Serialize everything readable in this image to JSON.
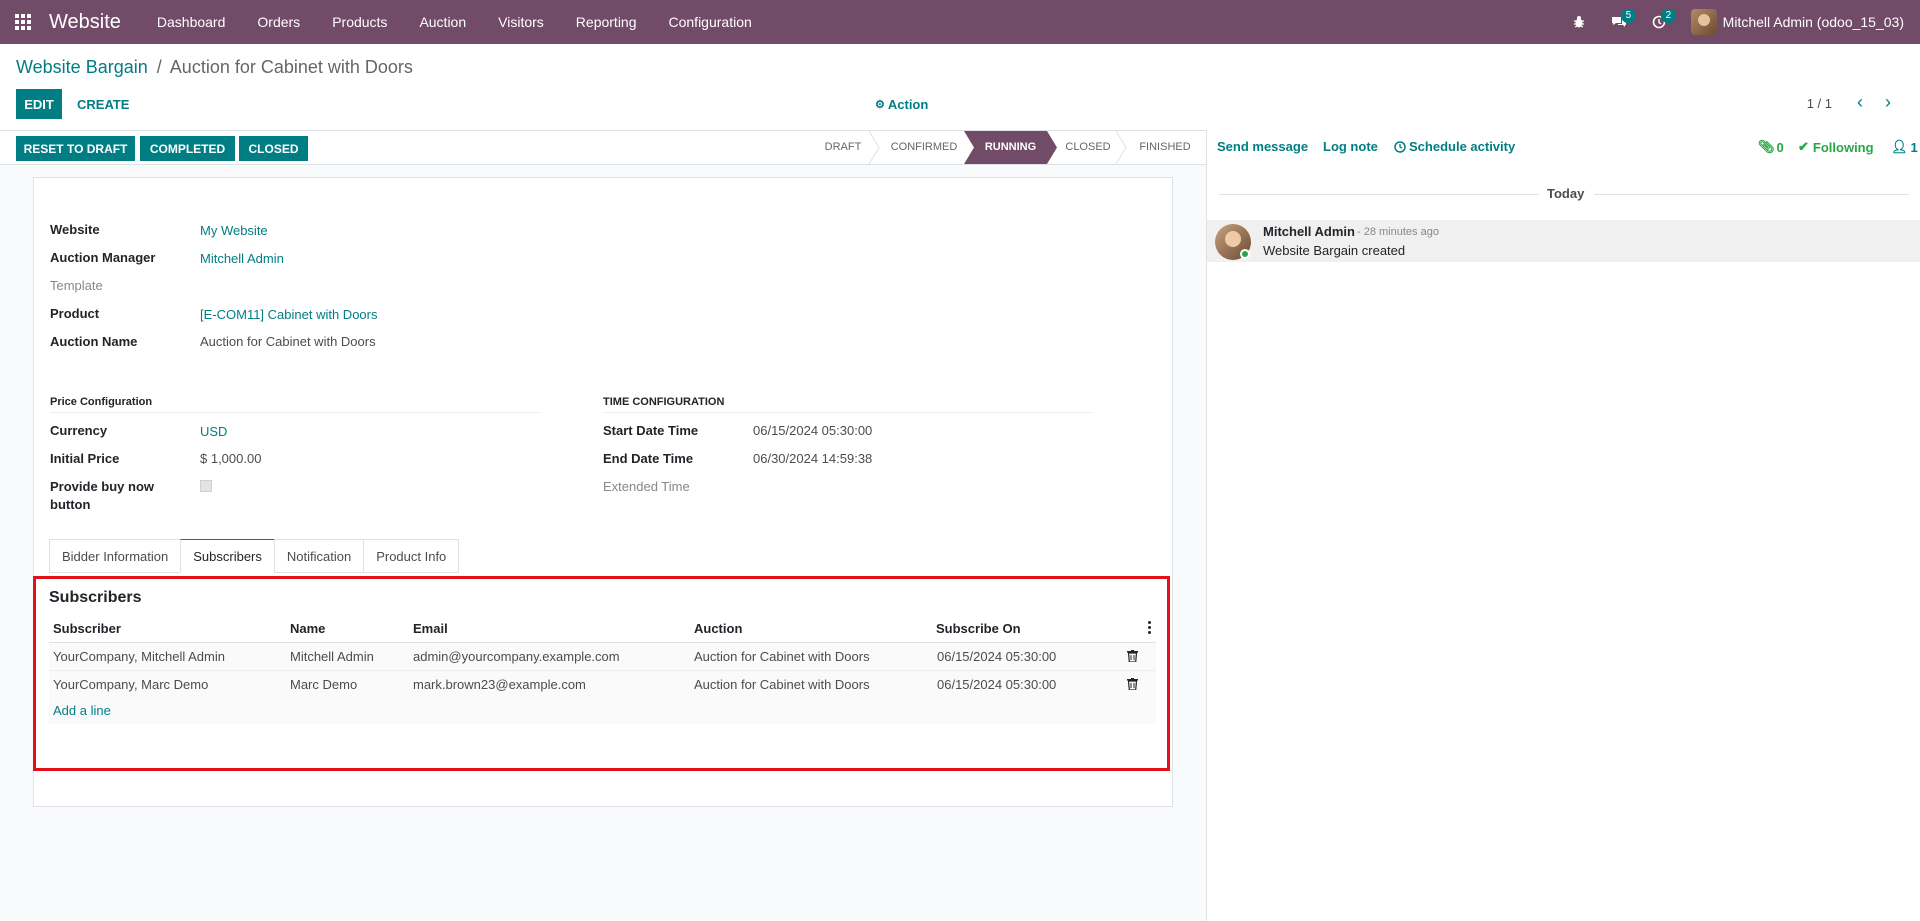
{
  "navbar": {
    "app_name": "Website",
    "menu": [
      "Dashboard",
      "Orders",
      "Products",
      "Auction",
      "Visitors",
      "Reporting",
      "Configuration"
    ],
    "messages_count": "5",
    "activities_count": "2",
    "user": "Mitchell Admin (odoo_15_03)"
  },
  "breadcrumb": {
    "parent": "Website Bargain",
    "separator": "/",
    "current": "Auction for Cabinet with Doors"
  },
  "control": {
    "edit": "EDIT",
    "create": "CREATE",
    "action": "Action",
    "pager": "1 / 1"
  },
  "statusbar": {
    "buttons": [
      "RESET TO DRAFT",
      "COMPLETED",
      "CLOSED"
    ],
    "stages": [
      "DRAFT",
      "CONFIRMED",
      "RUNNING",
      "CLOSED",
      "FINISHED"
    ],
    "active_stage": "RUNNING"
  },
  "form": {
    "website_label": "Website",
    "website_value": "My Website",
    "manager_label": "Auction Manager",
    "manager_value": "Mitchell Admin",
    "template_label": "Template",
    "product_label": "Product",
    "product_value": "[E-COM11] Cabinet with Doors",
    "name_label": "Auction Name",
    "name_value": "Auction for Cabinet with Doors",
    "price_section": "Price Configuration",
    "currency_label": "Currency",
    "currency_value": "USD",
    "initial_price_label": "Initial Price",
    "initial_price_value": "$ 1,000.00",
    "buy_now_label_1": "Provide buy now",
    "buy_now_label_2": "button",
    "time_section": "TIME CONFIGURATION",
    "start_label": "Start Date Time",
    "start_value": "06/15/2024 05:30:00",
    "end_label": "End Date Time",
    "end_value": "06/30/2024 14:59:38",
    "extended_label": "Extended Time"
  },
  "tabs": [
    "Bidder Information",
    "Subscribers",
    "Notification",
    "Product Info"
  ],
  "active_tab": "Subscribers",
  "subscribers": {
    "title": "Subscribers",
    "columns": [
      "Subscriber",
      "Name",
      "Email",
      "Auction",
      "Subscribe On"
    ],
    "rows": [
      [
        "YourCompany, Mitchell Admin",
        "Mitchell Admin",
        "admin@yourcompany.example.com",
        "Auction for Cabinet with Doors",
        "06/15/2024 05:30:00"
      ],
      [
        "YourCompany, Marc Demo",
        "Marc Demo",
        "mark.brown23@example.com",
        "Auction for Cabinet with Doors",
        "06/15/2024 05:30:00"
      ]
    ],
    "add_line": "Add a line"
  },
  "chatter": {
    "send_message": "Send message",
    "log_note": "Log note",
    "schedule_activity": "Schedule activity",
    "attachments": "0",
    "following": "Following",
    "followers": "1",
    "today": "Today",
    "author": "Mitchell Admin",
    "time": "- 28 minutes ago",
    "body": "Website Bargain created"
  },
  "colors": {
    "brand": "#714B67",
    "accent": "#017e84",
    "highlight_box": "#e3101a"
  }
}
